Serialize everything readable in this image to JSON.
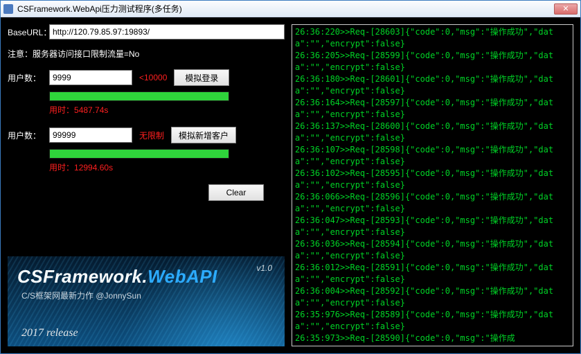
{
  "window": {
    "title": "CSFramework.WebApi压力测试程序(多任务)"
  },
  "baseurl": {
    "label": "BaseURL：",
    "value": "http://120.79.85.97:19893/"
  },
  "note": "注意：服务器访问接口限制流量=No",
  "login": {
    "label": "用户数：",
    "value": "9999",
    "limit": "<10000",
    "button": "模拟登录",
    "elapsed_label": "用时：",
    "elapsed": "5487.74s",
    "progress_pct": 100
  },
  "addcust": {
    "label": "用户数：",
    "value": "99999",
    "limit": "无限制",
    "button": "模拟新增客户",
    "elapsed_label": "用时：",
    "elapsed": "12994.60s",
    "progress_pct": 100
  },
  "clear": "Clear",
  "banner": {
    "title_cs": "CSFramework.",
    "title_web": "WebAPI",
    "version": "v1.0",
    "subtitle": "C/S框架网最新力作 @JonnySun",
    "release": "2017 release"
  },
  "log_lines": [
    "26:36:220>>Req-[28603]{\"code\":0,\"msg\":\"操作成功\",\"data\":\"\",\"encrypt\":false}",
    "26:36:205>>Req-[28599]{\"code\":0,\"msg\":\"操作成功\",\"data\":\"\",\"encrypt\":false}",
    "26:36:180>>Req-[28601]{\"code\":0,\"msg\":\"操作成功\",\"data\":\"\",\"encrypt\":false}",
    "26:36:164>>Req-[28597]{\"code\":0,\"msg\":\"操作成功\",\"data\":\"\",\"encrypt\":false}",
    "26:36:137>>Req-[28600]{\"code\":0,\"msg\":\"操作成功\",\"data\":\"\",\"encrypt\":false}",
    "26:36:107>>Req-[28598]{\"code\":0,\"msg\":\"操作成功\",\"data\":\"\",\"encrypt\":false}",
    "26:36:102>>Req-[28595]{\"code\":0,\"msg\":\"操作成功\",\"data\":\"\",\"encrypt\":false}",
    "26:36:066>>Req-[28596]{\"code\":0,\"msg\":\"操作成功\",\"data\":\"\",\"encrypt\":false}",
    "26:36:047>>Req-[28593]{\"code\":0,\"msg\":\"操作成功\",\"data\":\"\",\"encrypt\":false}",
    "26:36:036>>Req-[28594]{\"code\":0,\"msg\":\"操作成功\",\"data\":\"\",\"encrypt\":false}",
    "26:36:012>>Req-[28591]{\"code\":0,\"msg\":\"操作成功\",\"data\":\"\",\"encrypt\":false}",
    "26:36:004>>Req-[28592]{\"code\":0,\"msg\":\"操作成功\",\"data\":\"\",\"encrypt\":false}",
    "26:35:976>>Req-[28589]{\"code\":0,\"msg\":\"操作成功\",\"data\":\"\",\"encrypt\":false}",
    "26:35:973>>Req-[28590]{\"code\":0,\"msg\":\"操作成"
  ]
}
